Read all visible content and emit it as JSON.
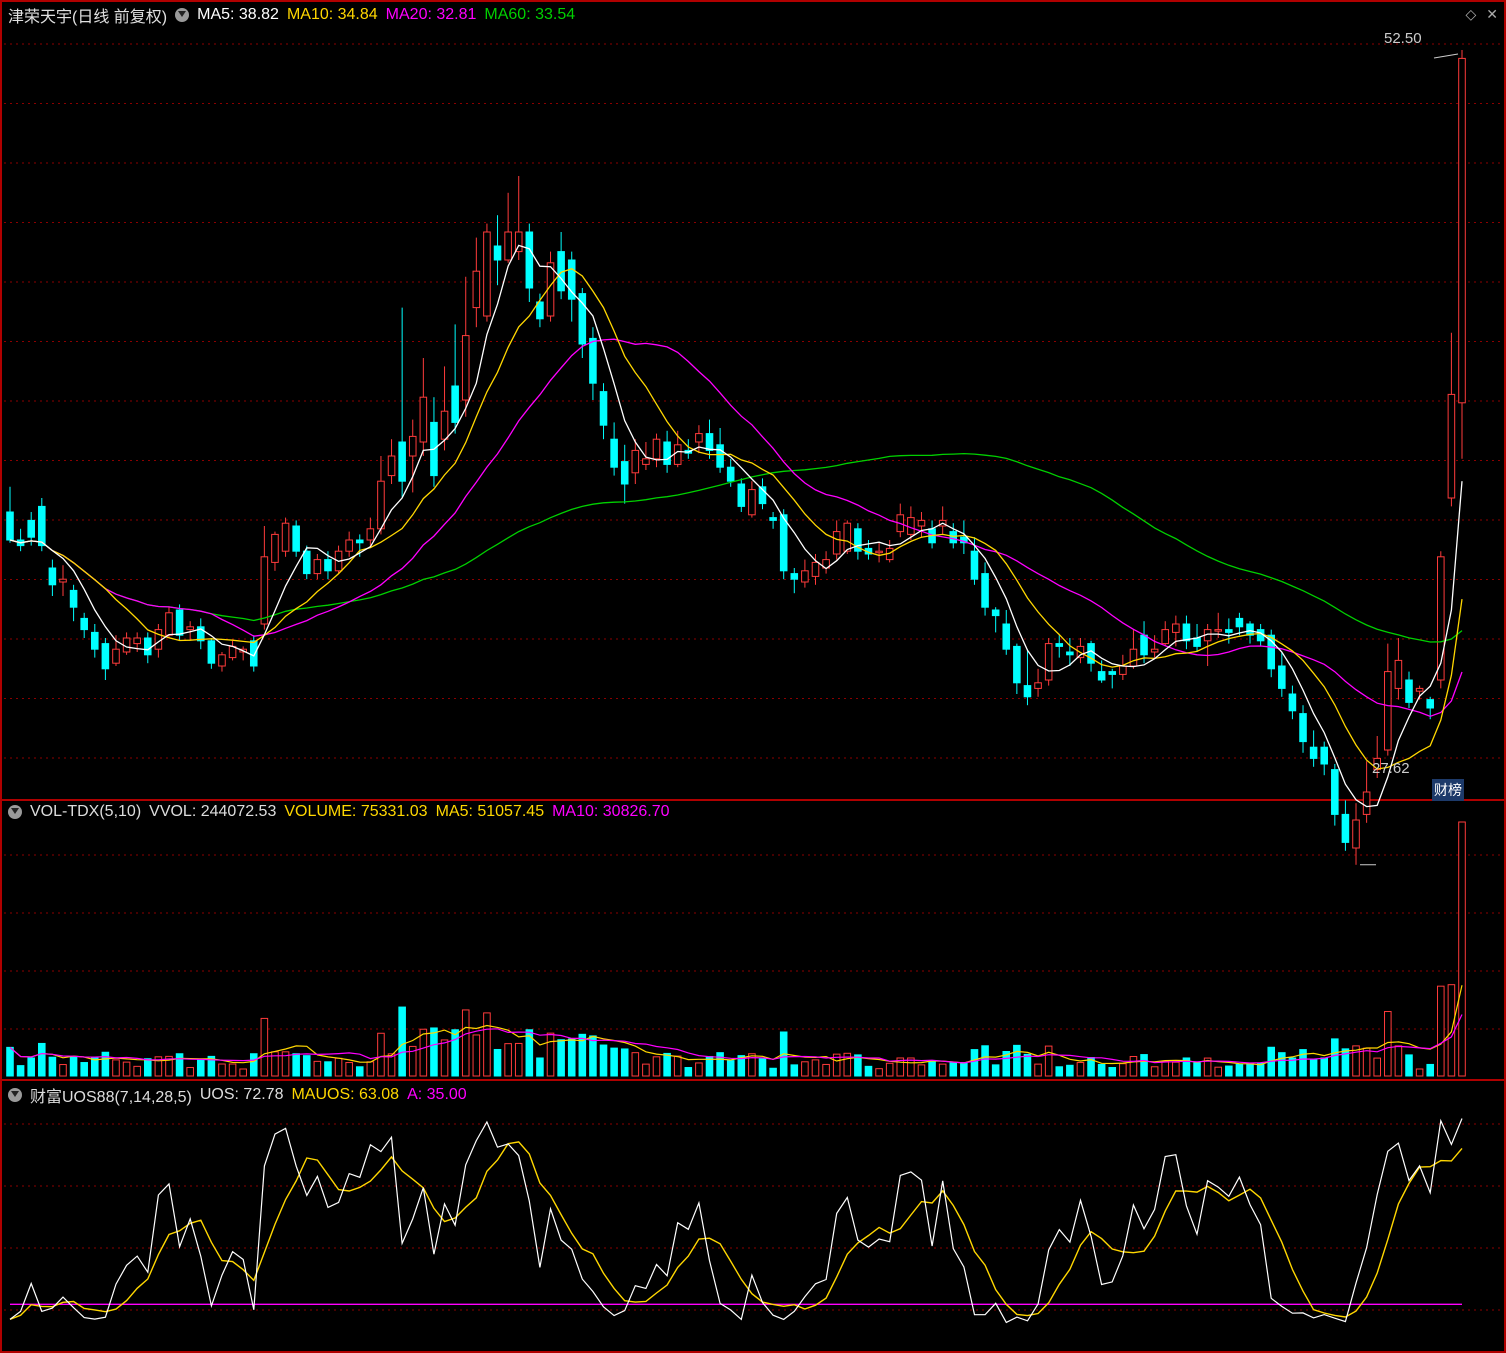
{
  "colors": {
    "up": "#ff3b3b",
    "down": "#00ffff",
    "ma5": "#ffffff",
    "ma10": "#ffd700",
    "ma20": "#ff00ff",
    "ma60": "#00d000",
    "grid": "#8b0000",
    "frame": "#b00000"
  },
  "price_panel": {
    "title": "津荣天宇(日线 前复权)",
    "ma5": "MA5: 38.82",
    "ma10": "MA10: 34.84",
    "ma20": "MA20: 32.81",
    "ma60": "MA60: 33.54",
    "high_label": "52.50",
    "low_label": "27.62",
    "badge": "财榜",
    "icons": [
      "diamond-icon",
      "close-icon"
    ]
  },
  "volume_panel": {
    "title": "VOL-TDX(5,10)",
    "vvol": "VVOL: 244072.53",
    "volume": "VOLUME: 75331.03",
    "ma5": "MA5: 51057.45",
    "ma10": "MA10: 30826.70"
  },
  "uos_panel": {
    "title": "财富UOS88(7,14,28,5)",
    "uos": "UOS: 72.78",
    "mauos": "MAUOS: 63.08",
    "a": "A: 35.00"
  },
  "chart_data": {
    "type": "candlestick",
    "ylim": [
      26.0,
      53.5
    ],
    "candles": [
      [
        36.0,
        35.0,
        36.9,
        34.9
      ],
      [
        35.0,
        34.8,
        35.4,
        34.6
      ],
      [
        35.7,
        35.1,
        36.0,
        34.8
      ],
      [
        36.2,
        34.8,
        36.5,
        34.6
      ],
      [
        34.0,
        33.4,
        34.3,
        33.0
      ],
      [
        33.5,
        33.6,
        34.1,
        33.0
      ],
      [
        33.2,
        32.6,
        33.4,
        32.1
      ],
      [
        32.2,
        31.8,
        32.4,
        31.5
      ],
      [
        31.7,
        31.1,
        32.0,
        30.8
      ],
      [
        31.3,
        30.4,
        31.5,
        30.0
      ],
      [
        30.6,
        31.1,
        31.6,
        30.5
      ],
      [
        31.0,
        31.5,
        31.7,
        30.9
      ],
      [
        31.3,
        31.5,
        31.7,
        31.0
      ],
      [
        31.5,
        30.9,
        31.7,
        30.6
      ],
      [
        31.1,
        31.8,
        32.0,
        30.8
      ],
      [
        31.6,
        32.4,
        32.6,
        31.5
      ],
      [
        32.5,
        31.6,
        32.7,
        31.4
      ],
      [
        31.8,
        31.9,
        32.1,
        31.4
      ],
      [
        31.9,
        31.4,
        32.2,
        31.1
      ],
      [
        31.4,
        30.6,
        31.5,
        30.4
      ],
      [
        30.5,
        30.9,
        31.0,
        30.3
      ],
      [
        30.8,
        31.2,
        31.4,
        30.7
      ],
      [
        31.0,
        31.1,
        31.2,
        30.7
      ],
      [
        31.4,
        30.5,
        31.6,
        30.3
      ],
      [
        32.0,
        34.4,
        35.5,
        31.8
      ],
      [
        34.2,
        35.2,
        35.3,
        33.9
      ],
      [
        34.6,
        35.6,
        35.8,
        34.4
      ],
      [
        35.5,
        34.6,
        35.7,
        34.4
      ],
      [
        34.6,
        33.8,
        34.8,
        33.6
      ],
      [
        33.8,
        34.3,
        34.5,
        33.6
      ],
      [
        34.3,
        33.9,
        34.6,
        33.6
      ],
      [
        33.9,
        34.6,
        34.8,
        33.8
      ],
      [
        34.6,
        35.0,
        35.3,
        34.4
      ],
      [
        35.0,
        34.9,
        35.2,
        34.4
      ],
      [
        35.0,
        35.4,
        35.8,
        34.8
      ],
      [
        35.4,
        37.1,
        38.0,
        35.2
      ],
      [
        37.3,
        38.0,
        38.6,
        37.0
      ],
      [
        38.5,
        37.1,
        43.3,
        36.5
      ],
      [
        38.0,
        38.7,
        39.3,
        36.7
      ],
      [
        38.5,
        40.1,
        41.5,
        38.0
      ],
      [
        39.2,
        37.3,
        40.1,
        36.9
      ],
      [
        38.6,
        39.6,
        41.2,
        38.2
      ],
      [
        40.5,
        39.2,
        42.7,
        38.8
      ],
      [
        40.0,
        42.3,
        44.4,
        39.4
      ],
      [
        43.3,
        44.6,
        45.8,
        42.6
      ],
      [
        43.0,
        46.0,
        46.3,
        42.8
      ],
      [
        45.5,
        45.0,
        46.6,
        44.1
      ],
      [
        45.0,
        46.0,
        47.4,
        44.9
      ],
      [
        45.3,
        46.0,
        48.0,
        45.0
      ],
      [
        46.0,
        44.0,
        46.3,
        43.5
      ],
      [
        43.5,
        42.9,
        43.8,
        42.6
      ],
      [
        43.0,
        44.9,
        45.3,
        42.8
      ],
      [
        45.3,
        43.9,
        46.0,
        43.6
      ],
      [
        45.0,
        43.6,
        45.3,
        42.8
      ],
      [
        43.8,
        42.0,
        44.0,
        41.5
      ],
      [
        42.2,
        40.6,
        42.6,
        40.0
      ],
      [
        40.3,
        39.1,
        40.6,
        38.6
      ],
      [
        38.6,
        37.6,
        39.2,
        37.3
      ],
      [
        37.8,
        37.0,
        38.4,
        36.3
      ],
      [
        37.4,
        38.2,
        38.6,
        37.0
      ],
      [
        37.7,
        37.9,
        38.5,
        37.5
      ],
      [
        37.9,
        38.6,
        38.8,
        37.6
      ],
      [
        38.5,
        37.7,
        38.9,
        37.4
      ],
      [
        37.7,
        38.4,
        38.9,
        37.6
      ],
      [
        38.2,
        38.1,
        38.6,
        37.9
      ],
      [
        38.5,
        38.8,
        39.1,
        38.1
      ],
      [
        38.8,
        38.2,
        39.3,
        37.9
      ],
      [
        38.4,
        37.6,
        39.0,
        37.4
      ],
      [
        37.6,
        37.1,
        37.9,
        36.9
      ],
      [
        37.0,
        36.2,
        37.2,
        36.0
      ],
      [
        35.9,
        36.8,
        37.1,
        35.8
      ],
      [
        36.9,
        36.3,
        37.2,
        36.1
      ],
      [
        35.8,
        35.7,
        36.0,
        35.4
      ],
      [
        35.9,
        33.9,
        36.1,
        33.6
      ],
      [
        33.8,
        33.6,
        34.0,
        33.1
      ],
      [
        33.5,
        33.9,
        34.3,
        33.3
      ],
      [
        33.7,
        34.2,
        34.5,
        33.4
      ],
      [
        34.0,
        34.3,
        34.6,
        33.8
      ],
      [
        34.5,
        35.3,
        35.7,
        34.3
      ],
      [
        34.6,
        35.6,
        35.7,
        34.5
      ],
      [
        35.4,
        34.6,
        35.6,
        34.3
      ],
      [
        34.7,
        34.5,
        35.0,
        34.3
      ],
      [
        34.6,
        34.6,
        34.9,
        34.2
      ],
      [
        34.3,
        34.7,
        35.0,
        34.2
      ],
      [
        35.3,
        35.9,
        36.3,
        35.1
      ],
      [
        35.2,
        35.8,
        36.2,
        35.0
      ],
      [
        35.5,
        35.7,
        36.0,
        35.1
      ],
      [
        35.4,
        34.9,
        35.7,
        34.7
      ],
      [
        35.5,
        35.7,
        36.2,
        35.2
      ],
      [
        35.3,
        34.9,
        35.6,
        34.7
      ],
      [
        35.1,
        34.9,
        35.7,
        34.5
      ],
      [
        34.6,
        33.6,
        35.1,
        33.4
      ],
      [
        33.8,
        32.6,
        34.2,
        32.3
      ],
      [
        32.5,
        32.3,
        32.6,
        31.7
      ],
      [
        32.0,
        31.1,
        32.5,
        30.9
      ],
      [
        31.2,
        29.9,
        31.3,
        29.5
      ],
      [
        29.8,
        29.4,
        31.1,
        29.1
      ],
      [
        29.7,
        29.9,
        30.4,
        29.4
      ],
      [
        30.0,
        31.3,
        31.5,
        29.8
      ],
      [
        31.3,
        31.2,
        31.6,
        30.8
      ],
      [
        31.0,
        30.9,
        31.5,
        30.5
      ],
      [
        30.8,
        31.2,
        31.5,
        30.6
      ],
      [
        31.3,
        30.6,
        31.4,
        30.3
      ],
      [
        30.3,
        30.0,
        30.7,
        29.9
      ],
      [
        30.3,
        30.2,
        30.4,
        29.7
      ],
      [
        30.2,
        30.5,
        30.9,
        30.0
      ],
      [
        30.5,
        31.1,
        31.8,
        30.4
      ],
      [
        31.6,
        30.9,
        32.1,
        30.6
      ],
      [
        31.0,
        31.1,
        31.6,
        30.8
      ],
      [
        31.3,
        31.8,
        32.1,
        31.2
      ],
      [
        31.7,
        32.0,
        32.3,
        31.2
      ],
      [
        32.0,
        31.4,
        32.3,
        31.1
      ],
      [
        31.5,
        31.2,
        32.0,
        31.0
      ],
      [
        31.4,
        31.8,
        32.0,
        30.5
      ],
      [
        31.8,
        31.8,
        32.4,
        31.5
      ],
      [
        31.8,
        31.7,
        32.2,
        31.3
      ],
      [
        32.2,
        31.9,
        32.4,
        31.6
      ],
      [
        32.0,
        31.6,
        32.1,
        31.3
      ],
      [
        31.8,
        31.4,
        32.0,
        31.2
      ],
      [
        31.6,
        30.4,
        31.8,
        30.1
      ],
      [
        30.5,
        29.7,
        31.0,
        29.4
      ],
      [
        29.5,
        28.9,
        29.8,
        28.6
      ],
      [
        28.8,
        27.8,
        29.1,
        27.4
      ],
      [
        27.6,
        27.2,
        28.2,
        26.9
      ],
      [
        27.6,
        27.0,
        27.8,
        26.6
      ],
      [
        26.8,
        25.2,
        27.0,
        24.8
      ],
      [
        25.2,
        24.2,
        25.7,
        23.9
      ],
      [
        24.0,
        25.0,
        25.6,
        23.4
      ],
      [
        25.2,
        26.0,
        27.1,
        24.9
      ],
      [
        26.8,
        27.2,
        28.0,
        26.5
      ],
      [
        27.5,
        30.3,
        31.3,
        27.3
      ],
      [
        29.7,
        30.7,
        31.5,
        29.3
      ],
      [
        30.0,
        29.2,
        30.3,
        29.0
      ],
      [
        29.6,
        29.7,
        29.8,
        29.3
      ],
      [
        29.3,
        29.0,
        29.4,
        28.6
      ],
      [
        30.0,
        34.4,
        34.6,
        29.7
      ],
      [
        36.5,
        40.2,
        42.4,
        36.2
      ],
      [
        39.9,
        52.2,
        52.5,
        37.9
      ]
    ]
  }
}
